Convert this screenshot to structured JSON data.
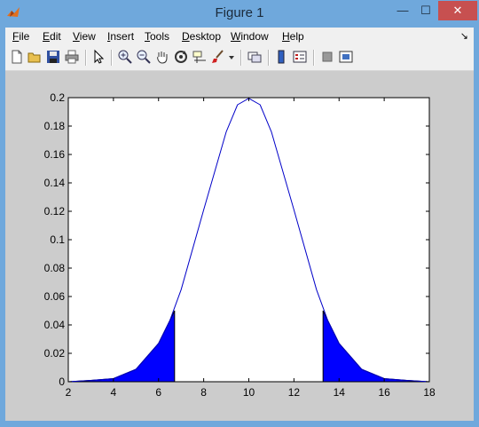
{
  "window": {
    "title": "Figure 1"
  },
  "title_buttons": {
    "minimize": "—",
    "maximize": "☐",
    "close": "✕"
  },
  "menu": [
    {
      "label": "File"
    },
    {
      "label": "Edit"
    },
    {
      "label": "View"
    },
    {
      "label": "Insert"
    },
    {
      "label": "Tools"
    },
    {
      "label": "Desktop"
    },
    {
      "label": "Window"
    },
    {
      "label": "Help"
    }
  ],
  "toolbar_icons": [
    "new-figure-icon",
    "open-file-icon",
    "save-icon",
    "print-icon",
    "edit-plot-arrow-icon",
    "zoom-in-icon",
    "zoom-out-icon",
    "pan-hand-icon",
    "rotate-3d-icon",
    "data-cursor-icon",
    "brush-icon",
    "brush-dropdown-icon",
    "link-plot-icon",
    "colorbar-icon",
    "legend-icon",
    "hide-plot-tools-icon",
    "show-plot-tools-icon"
  ],
  "chart_data": {
    "type": "area",
    "title": "",
    "xlabel": "",
    "ylabel": "",
    "xlim": [
      2,
      18
    ],
    "ylim": [
      0,
      0.2
    ],
    "x_ticks": [
      "2",
      "4",
      "6",
      "8",
      "10",
      "12",
      "14",
      "16",
      "18"
    ],
    "y_ticks": [
      "0",
      "0.02",
      "0.04",
      "0.06",
      "0.08",
      "0.1",
      "0.12",
      "0.14",
      "0.16",
      "0.18",
      "0.2"
    ],
    "grid": false,
    "series": [
      {
        "type": "line",
        "color": "#0000c8",
        "x": [
          2,
          3,
          4,
          5,
          6,
          6.5,
          7,
          8,
          9,
          9.5,
          10,
          10.5,
          11,
          12,
          13,
          13.5,
          14,
          15,
          16,
          17,
          18
        ],
        "values": [
          0.0,
          0.0009,
          0.0022,
          0.0088,
          0.027,
          0.0431,
          0.0648,
          0.121,
          0.176,
          0.195,
          0.1995,
          0.195,
          0.176,
          0.121,
          0.0648,
          0.0431,
          0.027,
          0.0088,
          0.0022,
          0.0009,
          0.0
        ]
      },
      {
        "type": "area",
        "color": "#0000ff",
        "x": [
          2,
          3,
          4,
          5,
          6,
          6.5,
          6.71
        ],
        "values": [
          0.0,
          0.0009,
          0.0022,
          0.0088,
          0.027,
          0.0431,
          0.05
        ]
      },
      {
        "type": "area",
        "color": "#0000ff",
        "x": [
          13.29,
          13.5,
          14,
          15,
          16,
          17,
          18
        ],
        "values": [
          0.05,
          0.0431,
          0.027,
          0.0088,
          0.0022,
          0.0009,
          0.0
        ]
      }
    ]
  },
  "colors": {
    "titlebar": "#6fa8dc",
    "figure_bg": "#cccccc",
    "axes_bg": "#ffffff",
    "close_button": "#c75050"
  }
}
